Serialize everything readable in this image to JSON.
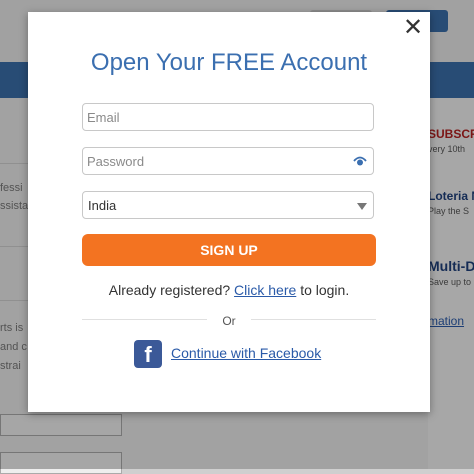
{
  "modal": {
    "title": "Open Your FREE Account",
    "close_glyph": "✕",
    "email_placeholder": "Email",
    "password_placeholder": "Password",
    "password_toggle_icon": "eye-icon",
    "country_selected": "India",
    "signup_label": "SIGN UP",
    "already_registered_text": "Already registered?",
    "click_here_label": "Click here",
    "to_login_text": "to login.",
    "or_text": "Or",
    "facebook_glyph": "f",
    "facebook_label": "Continue with Facebook",
    "accent_color": "#f37321",
    "title_color": "#3b6fb0",
    "facebook_color": "#3b5998"
  },
  "background": {
    "ads": [
      {
        "title": "SUBSCR",
        "sub": "very 10th"
      },
      {
        "title": "Loteria N",
        "sub": "Play the S"
      },
      {
        "title": "Multi-D",
        "sub": "Save up to"
      }
    ],
    "more_link": "mation",
    "left_fragments": [
      "fessi",
      "ssista",
      "rts is",
      "and c",
      "strai"
    ]
  }
}
